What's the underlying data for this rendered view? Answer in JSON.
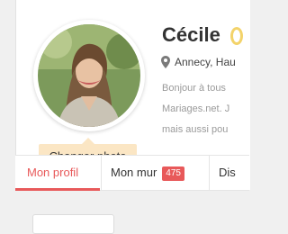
{
  "profile": {
    "name": "Cécile",
    "location": "Annecy, Hau",
    "bio_lines": [
      "Bonjour à tous",
      "Mariages.net. J",
      "mais aussi pou"
    ]
  },
  "tooltip": {
    "label": "Changer photo"
  },
  "tabs": [
    {
      "label": "Mon profil",
      "active": true
    },
    {
      "label": "Mon mur",
      "badge": "475"
    },
    {
      "label": "Dis"
    }
  ],
  "colors": {
    "accent": "#e8595a",
    "tooltip_bg": "#fbe6c4"
  },
  "icons": {
    "location": "map-pin-icon"
  }
}
